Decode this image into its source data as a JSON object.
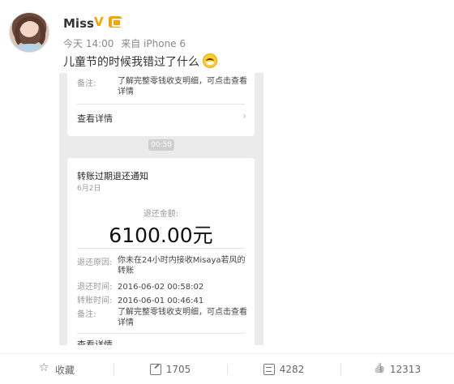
{
  "post": {
    "username": "Miss",
    "vip_mark": "V",
    "time": "今天 14:00",
    "source": "来自 iPhone 6",
    "text": "儿童节的时候我错过了什么"
  },
  "screenshot": {
    "card1": {
      "note_key": "备注:",
      "note_value": "了解完整零钱收支明细，可点击查看详情",
      "detail_link": "查看详情"
    },
    "time_pill": "00:58",
    "card2": {
      "title": "转账过期退还通知",
      "date": "6月2日",
      "refund_label": "退还金额:",
      "refund_amount": "6100.00元",
      "reason_key": "退还原因:",
      "reason_value": "你未在24小时内接收Misaya若风的转账",
      "return_time_key": "退还时间:",
      "return_time_value": "2016-06-02 00:58:02",
      "transfer_time_key": "转账时间:",
      "transfer_time_value": "2016-06-01 00:46:41",
      "note_key": "备注:",
      "note_value": "了解完整零钱收支明细，可点击查看详情",
      "detail_link": "查看详情"
    }
  },
  "actions": {
    "favorite": "收藏",
    "repost": "1705",
    "comment": "4282",
    "like": "12313"
  },
  "colors": {
    "vip": "#f6a400",
    "meta": "#888888",
    "bg_screenshot": "#ebebeb"
  }
}
